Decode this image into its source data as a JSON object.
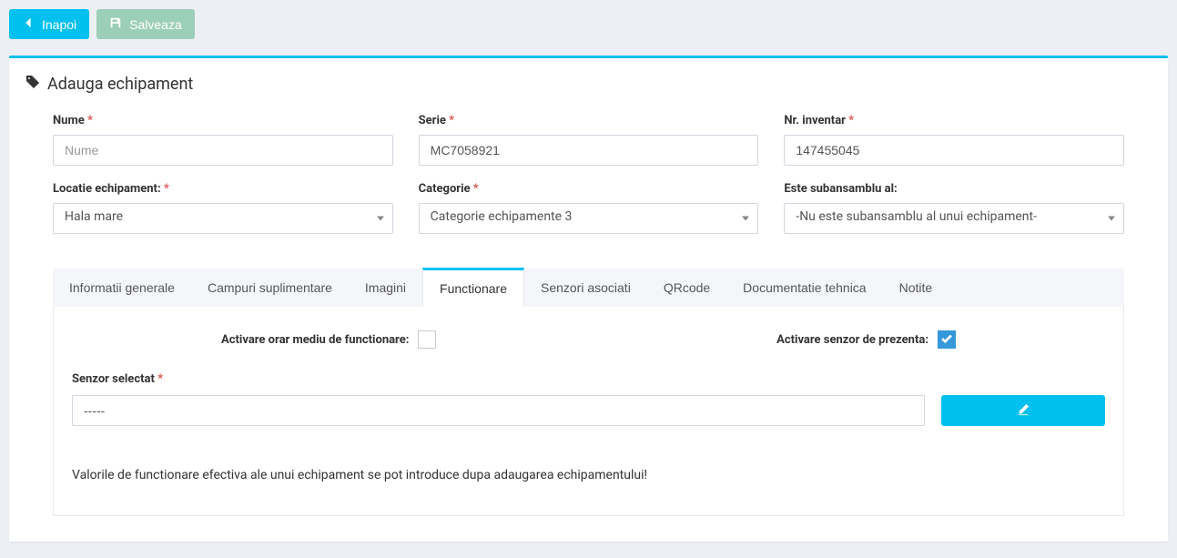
{
  "toolbar": {
    "back_label": "Inapoi",
    "save_label": "Salveaza"
  },
  "page": {
    "title": "Adauga echipament"
  },
  "form": {
    "name": {
      "label": "Nume",
      "required": true,
      "placeholder": "Nume",
      "value": ""
    },
    "serial": {
      "label": "Serie",
      "required": true,
      "value": "MC7058921"
    },
    "inventory": {
      "label": "Nr. inventar",
      "required": true,
      "value": "147455045"
    },
    "location": {
      "label": "Locatie echipament:",
      "required": true,
      "value": "Hala mare"
    },
    "category": {
      "label": "Categorie",
      "required": true,
      "value": "Categorie echipamente 3"
    },
    "subassembly": {
      "label": "Este subansamblu al:",
      "required": false,
      "value": "-Nu este subansamblu al unui echipament-"
    }
  },
  "tabs": [
    {
      "label": "Informatii generale",
      "active": false
    },
    {
      "label": "Campuri suplimentare",
      "active": false
    },
    {
      "label": "Imagini",
      "active": false
    },
    {
      "label": "Functionare",
      "active": true
    },
    {
      "label": "Senzori asociati",
      "active": false
    },
    {
      "label": "QRcode",
      "active": false
    },
    {
      "label": "Documentatie tehnica",
      "active": false
    },
    {
      "label": "Notite",
      "active": false
    }
  ],
  "functioning": {
    "schedule_label": "Activare orar mediu de functionare:",
    "schedule_checked": false,
    "presence_label": "Activare senzor de prezenta:",
    "presence_checked": true,
    "sensor_label": "Senzor selectat",
    "sensor_required": true,
    "sensor_value": "-----",
    "info_text": "Valorile de functionare efectiva ale unui echipament se pot introduce dupa adaugarea echipamentului!"
  }
}
